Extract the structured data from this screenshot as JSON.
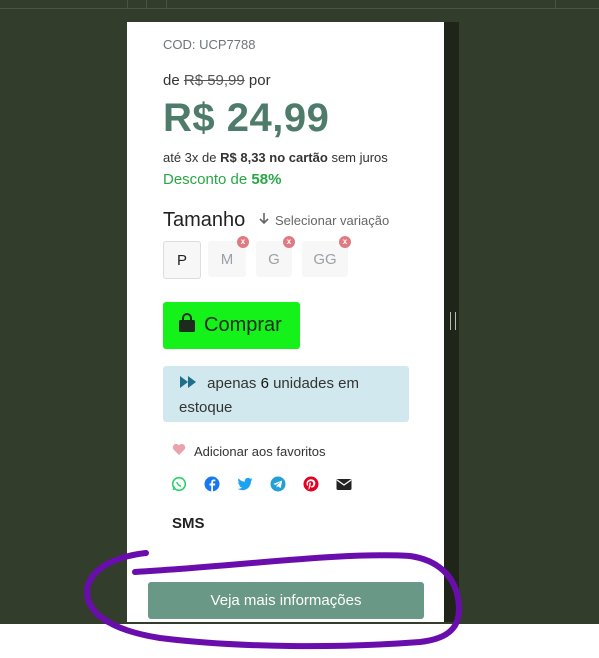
{
  "product": {
    "code": "COD: UCP7788",
    "price_prefix": "de",
    "old_price": "R$ 59,99",
    "price_suffix": "por",
    "price": "R$ 24,99",
    "installments_prefix": "até 3x de",
    "installment_value": "R$ 8,33",
    "installments_card": "no cartão",
    "installments_suffix": "sem juros",
    "discount_label": "Desconto de",
    "discount_value": "58%"
  },
  "size": {
    "title": "Tamanho",
    "select_label": "Selecionar variação",
    "options": [
      {
        "label": "P",
        "available": true
      },
      {
        "label": "M",
        "available": false
      },
      {
        "label": "G",
        "available": false
      },
      {
        "label": "GG",
        "available": false
      }
    ],
    "unavailable_mark": "x"
  },
  "buy_button": {
    "label": "Comprar",
    "color": "#14f21a"
  },
  "stock": {
    "prefix": "apenas",
    "count": "6",
    "suffix": "unidades em",
    "line2": "estoque"
  },
  "favorites": {
    "label": "Adicionar aos favoritos"
  },
  "share": {
    "icons": [
      "whatsapp-icon",
      "facebook-icon",
      "twitter-icon",
      "telegram-icon",
      "pinterest-icon",
      "email-icon"
    ]
  },
  "sms": {
    "label": "SMS"
  },
  "more_info": {
    "label": "Veja mais informações",
    "color": "#6a9886"
  },
  "colors": {
    "accent": "#4f7b6a",
    "discount": "#28a745",
    "annotation": "#6a0dad"
  }
}
